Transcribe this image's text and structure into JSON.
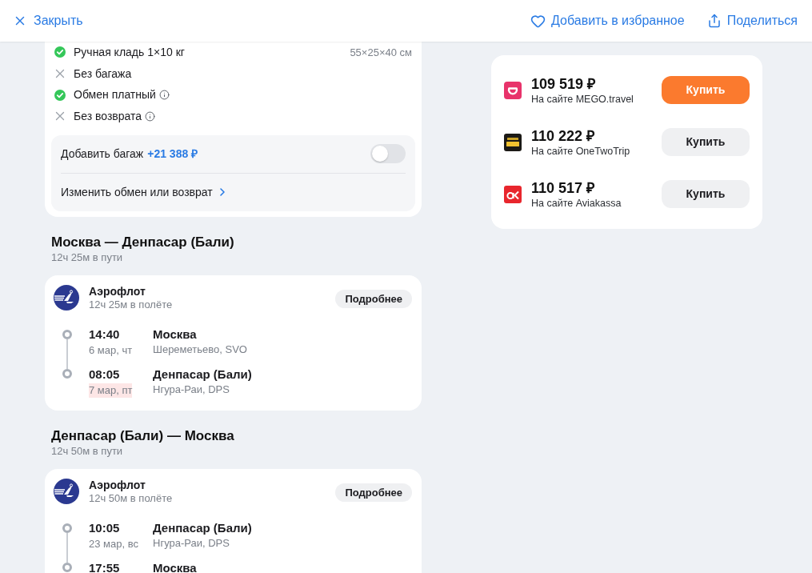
{
  "header": {
    "close": "Закрыть",
    "actions": [
      {
        "kind": "favorite",
        "label": "Добавить в избранное"
      },
      {
        "kind": "share",
        "label": "Поделиться"
      }
    ]
  },
  "tariff": {
    "items": [
      {
        "label": "Ручная кладь 1×10 кг",
        "included": true,
        "info": false,
        "size": "55×25×40 см"
      },
      {
        "label": "Без багажа",
        "included": false,
        "info": false
      },
      {
        "label": "Обмен платный",
        "included": true,
        "info": true
      },
      {
        "label": "Без возврата",
        "included": false,
        "info": true
      }
    ],
    "add_baggage": {
      "label": "Добавить багаж",
      "price": "+21 388 ₽",
      "on": false
    },
    "change_link": "Изменить обмен или возврат"
  },
  "segments": [
    {
      "title": "Москва — Денпасар (Бали)",
      "total": "12ч 25м в пути",
      "airline": "Аэрофлот",
      "flight_time": "12ч 25м в полёте",
      "details": "Подробнее",
      "stops": [
        {
          "time": "14:40",
          "date": "6 мар, чт",
          "date_highlight": false,
          "city": "Москва",
          "airport": "Шереметьево, SVO"
        },
        {
          "time": "08:05",
          "date": "7 мар, пт",
          "date_highlight": true,
          "city": "Денпасар (Бали)",
          "airport": "Нгура-Раи, DPS"
        }
      ]
    },
    {
      "title": "Денпасар (Бали) — Москва",
      "total": "12ч 50м в пути",
      "airline": "Аэрофлот",
      "flight_time": "12ч 50м в полёте",
      "details": "Подробнее",
      "stops": [
        {
          "time": "10:05",
          "date": "23 мар, вс",
          "date_highlight": false,
          "city": "Денпасар (Бали)",
          "airport": "Нгура-Раи, DPS"
        },
        {
          "time": "17:55",
          "city": "Москва"
        }
      ]
    }
  ],
  "offers": [
    {
      "kind": "mego",
      "price": "109 519 ₽",
      "site": "На сайте MEGO.travel",
      "button": "Купить",
      "primary": true
    },
    {
      "kind": "onetwotrip",
      "price": "110 222 ₽",
      "site": "На сайте OneTwoTrip",
      "button": "Купить",
      "primary": false
    },
    {
      "kind": "aviakassa",
      "price": "110 517 ₽",
      "site": "На сайте Aviakassa",
      "button": "Купить",
      "primary": false
    }
  ]
}
